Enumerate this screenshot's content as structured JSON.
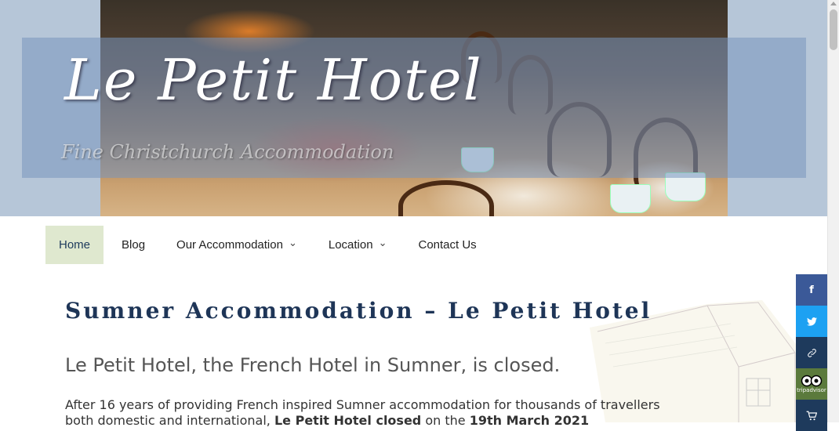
{
  "header": {
    "site_title": "Le Petit Hotel",
    "tagline": "Fine Christchurch Accommodation"
  },
  "nav": {
    "items": [
      {
        "label": "Home",
        "active": true,
        "has_dropdown": false
      },
      {
        "label": "Blog",
        "active": false,
        "has_dropdown": false
      },
      {
        "label": "Our Accommodation",
        "active": false,
        "has_dropdown": true
      },
      {
        "label": "Location",
        "active": false,
        "has_dropdown": true
      },
      {
        "label": "Contact Us",
        "active": false,
        "has_dropdown": false
      }
    ],
    "dropdown_icon": "chevron-down-icon"
  },
  "main": {
    "page_title": "Sumner Accommodation – Le Petit Hotel",
    "subheading": "Le Petit Hotel, the French Hotel in Sumner, is closed.",
    "paragraph_start": "After 16 years of providing French inspired Sumner accommodation for thousands of travellers both domestic and international, ",
    "paragraph_bold_1": "Le Petit Hotel closed",
    "paragraph_mid": " on the ",
    "paragraph_bold_2": "19th March 2021"
  },
  "share": {
    "buttons": [
      {
        "icon": "facebook-icon",
        "glyph": "f",
        "color": "#3b5998"
      },
      {
        "icon": "twitter-icon",
        "glyph": "🐦",
        "color": "#1da1f2"
      },
      {
        "icon": "link-icon",
        "glyph": "🔗",
        "color": "#1e3a5c"
      },
      {
        "icon": "tripadvisor-icon",
        "glyph": "oo",
        "color": "#5b7a3c"
      },
      {
        "icon": "cart-icon",
        "glyph": "🛒",
        "color": "#1e3a5c"
      }
    ],
    "tripadvisor_label": "tripadvisor"
  },
  "colors": {
    "accent": "#1e3557",
    "nav_active_bg": "#dfe8cf",
    "header_bg": "#b6c6d8"
  }
}
